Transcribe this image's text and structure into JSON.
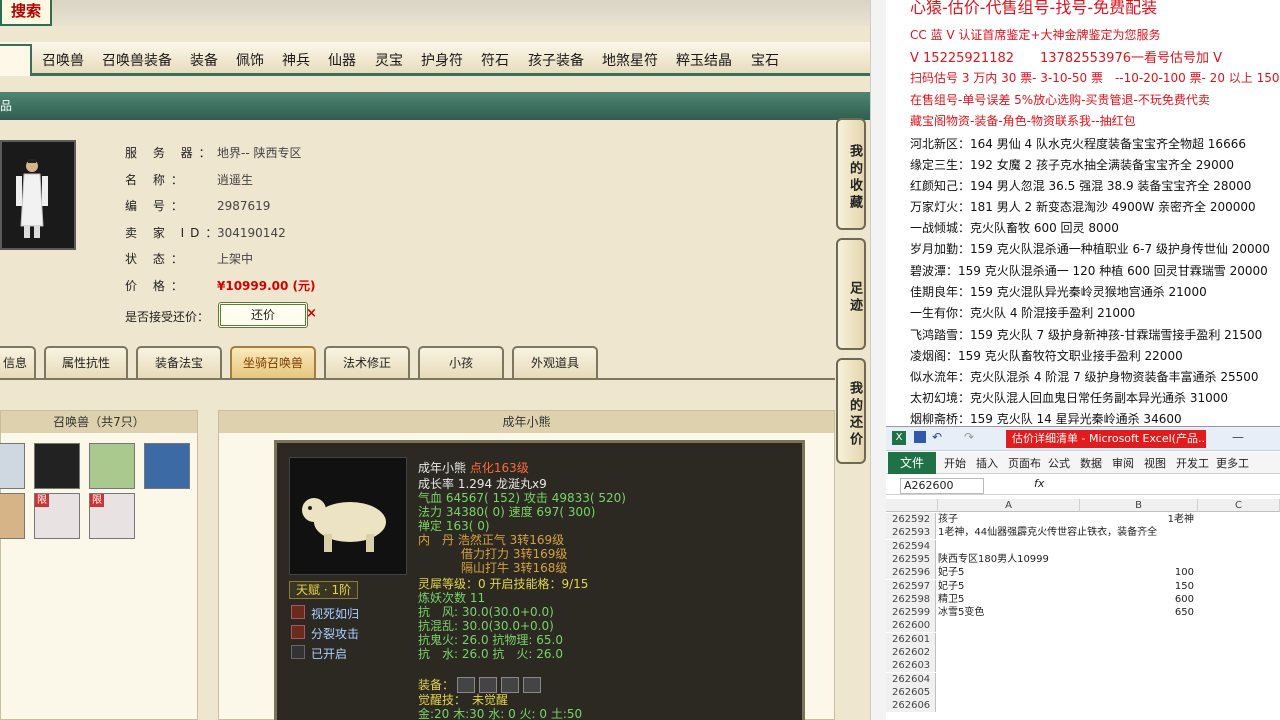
{
  "header": {
    "search_logo": "搜索",
    "nav": [
      "召唤兽",
      "召唤兽装备",
      "装备",
      "佩饰",
      "神兵",
      "仙器",
      "灵宝",
      "护身符",
      "符石",
      "孩子装备",
      "地煞星符",
      "粹玉结晶",
      "宝石"
    ],
    "section_title": "品"
  },
  "role": {
    "server_label": "服 务 器：",
    "server_value": "地界-- 陕西专区",
    "name_label": "名 称：",
    "name_value": "逍遥生",
    "id_label": "编 号：",
    "id_value": "2987619",
    "seller_label": "卖 家 ID：",
    "seller_value": "304190142",
    "status_label": "状 态：",
    "status_value": "上架中",
    "price_label": "价 格：",
    "price_value": "¥10999.00 (元)",
    "bargain_label": "是否接受还价：",
    "bargain_button": "还价",
    "bargain_x": "×"
  },
  "tabs": [
    "信息",
    "属性抗性",
    "装备法宝",
    "坐骑召唤兽",
    "法术修正",
    "小孩",
    "外观道具"
  ],
  "active_tab": "坐骑召唤兽",
  "side_buttons": [
    "我的收藏",
    "足迹",
    "我的还价"
  ],
  "pets": {
    "header": "召唤兽（共7只）",
    "detail_header": "成年小熊",
    "badge": "限"
  },
  "pet_detail": {
    "name": "成年小熊",
    "name_extra": "点化163级",
    "growth": "成长率 1.294 龙涎丸x9",
    "hp": "气血 64567( 152) 攻击 49833( 520)",
    "mp": "法力 34380( 0) 速度 697( 300)",
    "def": "禅定 163( 0)",
    "neidan1": "内　丹 浩然正气 3转169级",
    "neidan2": "借力打力 3转169级",
    "neidan3": "隔山打牛 3转168级",
    "spirit": "灵犀等级：0 开启技能格：9/15",
    "refine": "炼妖次数 11",
    "res1": "抗　风: 30.0(30.0+0.0)",
    "res2": "抗混乱: 30.0(30.0+0.0)",
    "res3": "抗鬼火: 26.0 抗物理: 65.0",
    "res4": "抗　水: 26.0 抗　火: 26.0",
    "talent": "天赋 · 1阶",
    "skills": [
      "视死如归",
      "分裂攻击",
      "已开启"
    ],
    "equip_label": "装备：",
    "awake": "觉醒技：　未觉醒",
    "elements": "金:20 木:30 水: 0 火: 0 土:50"
  },
  "ad": {
    "line0": "心猿-估价-代售组号-找号-免费配装",
    "line1": "CC 蓝 V 认证首席鉴定+大神金牌鉴定为您服务",
    "line2": "V 15225921182　　13782553976一看号估号加 V",
    "line3": "扫码估号 3 万内 30 票- 3-10-50 票　--10-20-100 票- 20 以上 150",
    "line4": "在售组号-单号误差 5%放心选购-买贵管退-不玩免费代卖",
    "line5": "藏宝阁物资-装备-角色-物资联系我--抽红包",
    "listings": [
      "河北新区：164 男仙 4 队水克火程度装备宝宝齐全物超 16666",
      "缘定三生：192 女魔 2 孩子克水抽全满装备宝宝齐全 29000",
      "红颜知己：194 男人忽混 36.5 强混 38.9 装备宝宝齐全 28000",
      "万家灯火：181 男人 2 新变态混淘沙 4900W 亲密齐全 200000",
      "一战倾城：克火队畜牧 600 回灵 8000",
      "岁月加勤：159 克火队混杀通一种植职业 6-7 级护身传世仙 20000",
      "碧波潭：159 克火队混杀通一 120 种植 600 回灵甘霖瑞雪 20000",
      "佳期良年：159 克火混队异光秦岭灵猴地宫通杀 21000",
      "一生有你：克火队 4 阶混接手盈利 21000",
      "飞鸿踏雪：159 克火队 7 级护身新神孩-甘霖瑞雪接手盈利 21500",
      "凌烟阁：159 克火队畜牧符文职业接手盈利 22000",
      "似水流年：克火队混杀 4 阶混 7 级护身物资装备丰富通杀 25500",
      "太初幻境：克火队混人回血鬼日常任务副本异光通杀 31000",
      "烟柳斋桥：159 克火队 14 星异光秦岭通杀 34600"
    ]
  },
  "excel": {
    "title": "估价详细清单 - Microsoft Excel(产品...",
    "file": "文件",
    "ribbon": [
      "开始",
      "插入",
      "页面布",
      "公式",
      "数据",
      "审阅",
      "视图",
      "开发工",
      "更多工"
    ],
    "namebox": "A262600",
    "fx": "fx",
    "cols": [
      "A",
      "B",
      "C"
    ],
    "rows": [
      {
        "n": "262592",
        "a": "孩子",
        "b": "1老神"
      },
      {
        "n": "262593",
        "a": "1老神，44仙器强霹克火传世容止铁衣，装备齐全",
        "b": ""
      },
      {
        "n": "262594",
        "a": "",
        "b": ""
      },
      {
        "n": "262595",
        "a": "陕西专区180男人10999",
        "b": ""
      },
      {
        "n": "262596",
        "a": "妃子5",
        "b": "100"
      },
      {
        "n": "262597",
        "a": "妃子5",
        "b": "150"
      },
      {
        "n": "262598",
        "a": "精卫5",
        "b": "600"
      },
      {
        "n": "262599",
        "a": "冰雪5变色",
        "b": "650"
      },
      {
        "n": "262600",
        "a": "",
        "b": ""
      },
      {
        "n": "262601",
        "a": "",
        "b": ""
      },
      {
        "n": "262602",
        "a": "",
        "b": ""
      },
      {
        "n": "262603",
        "a": "",
        "b": ""
      },
      {
        "n": "262604",
        "a": "",
        "b": ""
      },
      {
        "n": "262605",
        "a": "",
        "b": ""
      },
      {
        "n": "262606",
        "a": "",
        "b": ""
      }
    ]
  }
}
